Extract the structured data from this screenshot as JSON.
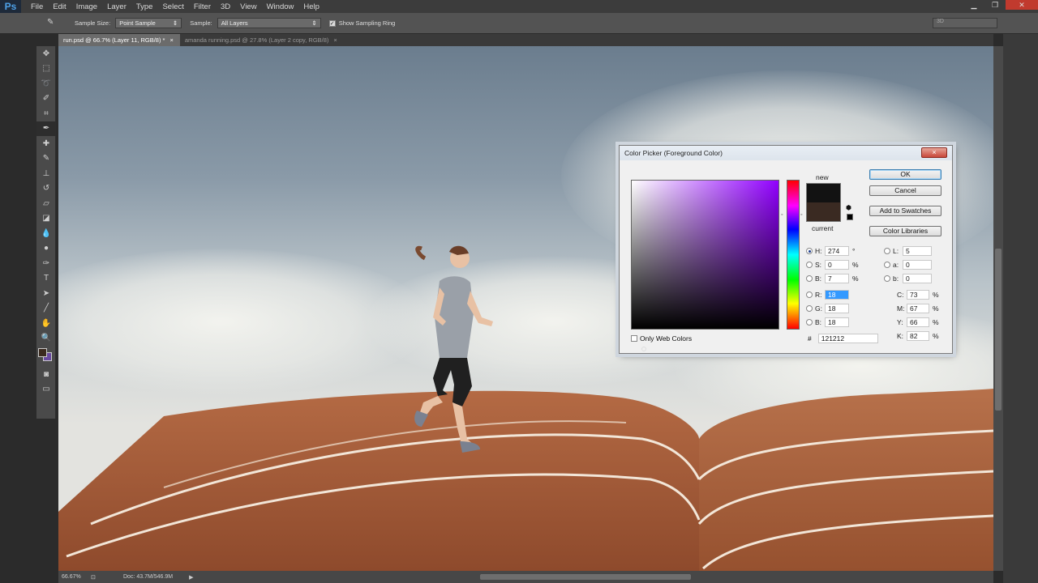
{
  "app": {
    "logo": "Ps",
    "menus": [
      "File",
      "Edit",
      "Image",
      "Layer",
      "Type",
      "Select",
      "Filter",
      "3D",
      "View",
      "Window",
      "Help"
    ]
  },
  "options": {
    "sample_size_label": "Sample Size:",
    "sample_size_value": "Point Sample",
    "sample_label": "Sample:",
    "sample_value": "All Layers",
    "show_ring_label": "Show Sampling Ring",
    "workspace": "3D"
  },
  "tabs": [
    {
      "label": "run.psd @ 66.7% (Layer 11, RGB/8) *",
      "close": "×"
    },
    {
      "label": "amanda running.psd @ 27.8% (Layer 2 copy, RGB/8)",
      "close": "×"
    }
  ],
  "status": {
    "zoom": "66.67%",
    "doc": "Doc: 43.7M/546.9M"
  },
  "picker": {
    "title": "Color Picker (Foreground Color)",
    "close": "×",
    "new_label": "new",
    "current_label": "current",
    "buttons": {
      "ok": "OK",
      "cancel": "Cancel",
      "add": "Add to Swatches",
      "libraries": "Color Libraries"
    },
    "hsb": [
      {
        "label": "H:",
        "value": "274",
        "unit": "°",
        "selected": true
      },
      {
        "label": "S:",
        "value": "0",
        "unit": "%",
        "selected": false
      },
      {
        "label": "B:",
        "value": "7",
        "unit": "%",
        "selected": false
      }
    ],
    "rgb": [
      {
        "label": "R:",
        "value": "18"
      },
      {
        "label": "G:",
        "value": "18"
      },
      {
        "label": "B:",
        "value": "18"
      }
    ],
    "lab": [
      {
        "label": "L:",
        "value": "5"
      },
      {
        "label": "a:",
        "value": "0"
      },
      {
        "label": "b:",
        "value": "0"
      }
    ],
    "cmyk": [
      {
        "label": "C:",
        "value": "73",
        "unit": "%"
      },
      {
        "label": "M:",
        "value": "67",
        "unit": "%"
      },
      {
        "label": "Y:",
        "value": "66",
        "unit": "%"
      },
      {
        "label": "K:",
        "value": "82",
        "unit": "%"
      }
    ],
    "only_web": "Only Web Colors",
    "hex_label": "#",
    "hex_value": "121212",
    "new_color": "#121212",
    "current_color": "#3a2a22"
  },
  "colors": {
    "foreground": "#3b2a1f",
    "background": "#6a4aa0",
    "accent": "#4ea1e8"
  }
}
